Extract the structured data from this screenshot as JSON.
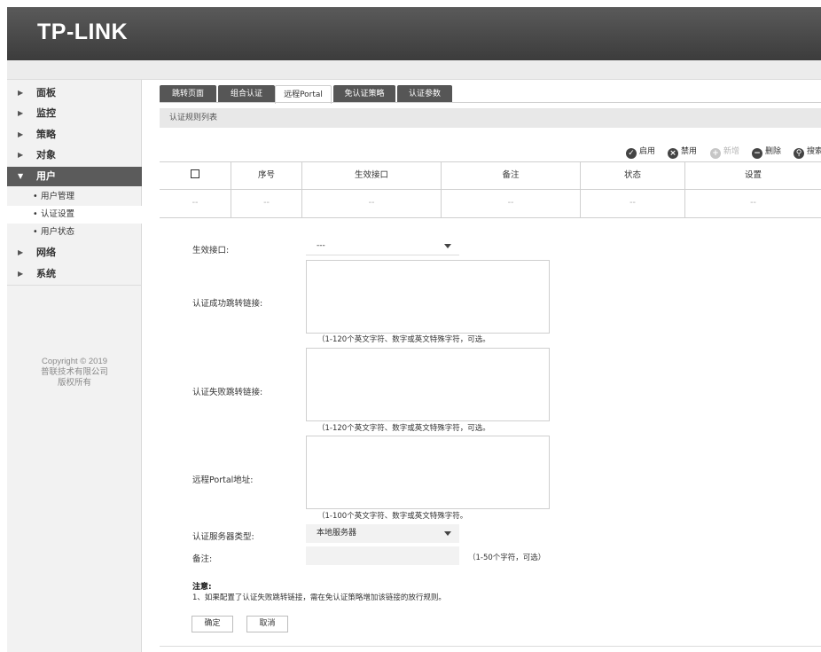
{
  "brand": {
    "logo_text": "TP-LINK"
  },
  "sidebar": {
    "items": [
      {
        "label": "面板",
        "expanded": false
      },
      {
        "label": "监控",
        "expanded": false
      },
      {
        "label": "策略",
        "expanded": false
      },
      {
        "label": "对象",
        "expanded": false
      },
      {
        "label": "用户",
        "expanded": true
      },
      {
        "label": "网络",
        "expanded": false
      },
      {
        "label": "系统",
        "expanded": false
      }
    ],
    "subitems": [
      {
        "label": "用户管理"
      },
      {
        "label": "认证设置",
        "active": true
      },
      {
        "label": "用户状态"
      }
    ],
    "copyright": {
      "line1": "Copyright © 2019",
      "line2": "普联技术有限公司",
      "line3": "版权所有"
    }
  },
  "tabs": [
    {
      "label": "跳转页面"
    },
    {
      "label": "组合认证"
    },
    {
      "label": "远程Portal",
      "active": true
    },
    {
      "label": "免认证策略"
    },
    {
      "label": "认证参数"
    }
  ],
  "section_title": "认证规则列表",
  "toolbar": {
    "enable": "启用",
    "disable": "禁用",
    "add": "新增",
    "delete": "删除",
    "search": "搜索"
  },
  "table": {
    "headers": [
      "",
      "序号",
      "生效接口",
      "备注",
      "状态",
      "设置"
    ],
    "row": [
      "--",
      "--",
      "--",
      "--",
      "--",
      "--"
    ]
  },
  "form": {
    "interface_label": "生效接口:",
    "interface_value": "---",
    "success_url_label": "认证成功跳转链接:",
    "success_url_hint": "（1-120个英文字符、数字或英文特殊字符，可选。",
    "fail_url_label": "认证失败跳转链接:",
    "fail_url_hint": "（1-120个英文字符、数字或英文特殊字符，可选。",
    "portal_label": "远程Portal地址:",
    "portal_hint": "（1-100个英文字符、数字或英文特殊字符。",
    "server_type_label": "认证服务器类型:",
    "server_type_value": "本地服务器",
    "remark_label": "备注:",
    "remark_hint": "（1-50个字符，可选）",
    "note_title": "注意:",
    "note_text": "1、如果配置了认证失败跳转链接，需在免认证策略增加该链接的放行规则。",
    "ok_label": "确定",
    "cancel_label": "取消"
  }
}
